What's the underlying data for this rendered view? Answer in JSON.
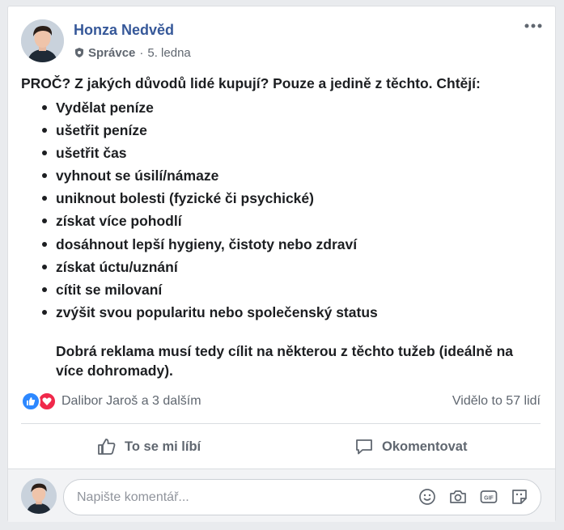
{
  "post": {
    "author": "Honza Nedvěd",
    "role": "Správce",
    "separator": "·",
    "date": "5. ledna",
    "intro": "PROČ? Z jakých důvodů lidé kupují? Pouze a jedině z těchto. Chtějí:",
    "items": [
      "Vydělat peníze",
      "ušetřit peníze",
      "ušetřit čas",
      "vyhnout se úsilí/námaze",
      "uniknout bolesti (fyzické či psychické)",
      "získat více pohodlí",
      "dosáhnout lepší hygieny, čistoty nebo zdraví",
      "získat úctu/uznání",
      "cítit se milovaní",
      "zvýšit svou popularitu nebo společenský status"
    ],
    "closing": "Dobrá reklama musí tedy cílit na některou z těchto tužeb (ideálně na více dohromady)."
  },
  "reactions": {
    "people": "Dalibor Jaroš a 3 dalším",
    "seen": "Vidělo to 57 lidí",
    "icons": [
      "like-icon",
      "love-icon"
    ],
    "colors": {
      "like": "#2d88ff",
      "love": "#f0284a"
    }
  },
  "actions": {
    "like_label": "To se mi líbí",
    "comment_label": "Okomentovat"
  },
  "comment": {
    "placeholder": "Napište komentář...",
    "tools": [
      "emoji-icon",
      "camera-icon",
      "gif-icon",
      "sticker-icon"
    ]
  },
  "colors": {
    "author_link": "#365899",
    "muted_text": "#606770",
    "page_background": "#e9ebee"
  }
}
